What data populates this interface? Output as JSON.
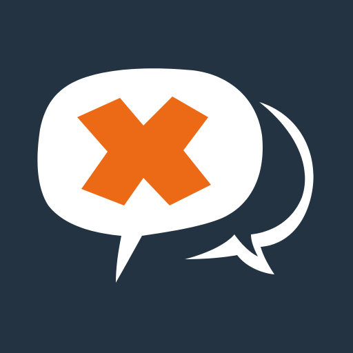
{
  "icon": {
    "name": "speech-bubbles-x-logo",
    "colors": {
      "background": "#233341",
      "bubble": "#ffffff",
      "mark": "#ec6a16"
    }
  }
}
